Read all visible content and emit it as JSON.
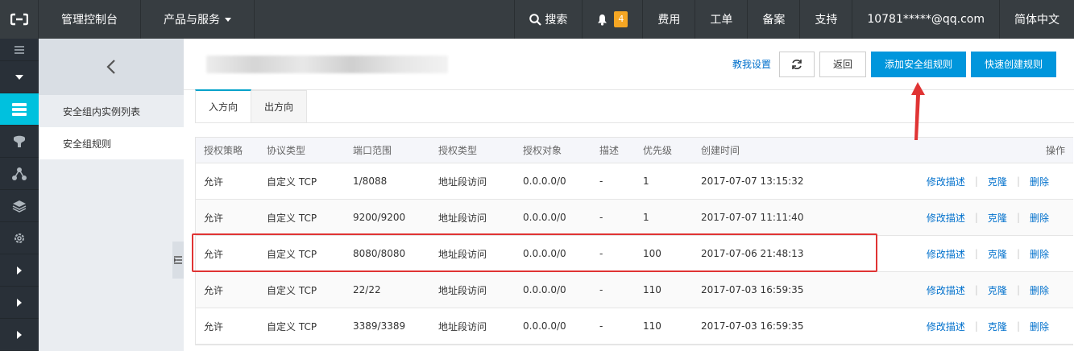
{
  "topbar": {
    "console": "管理控制台",
    "products": "产品与服务",
    "search": "搜索",
    "notify_count": "4",
    "billing": "费用",
    "ticket": "工单",
    "filing": "备案",
    "support": "支持",
    "account": "10781*****@qq.com",
    "language": "简体中文"
  },
  "sidebar": {
    "items": [
      {
        "label": "安全组内实例列表"
      },
      {
        "label": "安全组规则"
      }
    ]
  },
  "toolbar": {
    "help": "教我设置",
    "back": "返回",
    "add_rule": "添加安全组规则",
    "quick_create": "快速创建规则"
  },
  "tabs": [
    {
      "label": "入方向"
    },
    {
      "label": "出方向"
    }
  ],
  "table": {
    "headers": [
      "授权策略",
      "协议类型",
      "端口范围",
      "授权类型",
      "授权对象",
      "描述",
      "优先级",
      "创建时间",
      "操作"
    ],
    "rows": [
      [
        "允许",
        "自定义 TCP",
        "1/8088",
        "地址段访问",
        "0.0.0.0/0",
        "-",
        "1",
        "2017-07-07 13:15:32"
      ],
      [
        "允许",
        "自定义 TCP",
        "9200/9200",
        "地址段访问",
        "0.0.0.0/0",
        "-",
        "1",
        "2017-07-07 11:11:40"
      ],
      [
        "允许",
        "自定义 TCP",
        "8080/8080",
        "地址段访问",
        "0.0.0.0/0",
        "-",
        "100",
        "2017-07-06 21:48:13"
      ],
      [
        "允许",
        "自定义 TCP",
        "22/22",
        "地址段访问",
        "0.0.0.0/0",
        "-",
        "110",
        "2017-07-03 16:59:35"
      ],
      [
        "允许",
        "自定义 TCP",
        "3389/3389",
        "地址段访问",
        "0.0.0.0/0",
        "-",
        "110",
        "2017-07-03 16:59:35"
      ]
    ],
    "ops": {
      "edit_desc": "修改描述",
      "clone": "克隆",
      "delete": "删除"
    }
  },
  "colors": {
    "topbar": "#373d41",
    "accent": "#00c1de",
    "primary_button": "#0096dc",
    "link": "#0070cc",
    "highlight": "#e03434"
  }
}
